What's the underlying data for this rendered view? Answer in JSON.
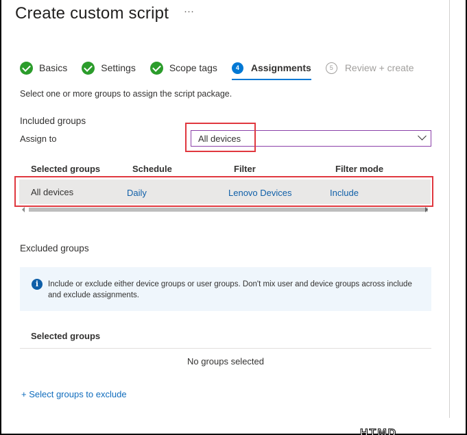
{
  "page": {
    "title": "Create custom script",
    "more": "···"
  },
  "wizard": {
    "steps": [
      {
        "label": "Basics",
        "state": "done"
      },
      {
        "label": "Settings",
        "state": "done"
      },
      {
        "label": "Scope tags",
        "state": "done"
      },
      {
        "label": "Assignments",
        "state": "active",
        "number": "4"
      },
      {
        "label": "Review + create",
        "state": "todo",
        "number": "5"
      }
    ]
  },
  "assignments": {
    "description": "Select one or more groups to assign the script package.",
    "included_label": "Included groups",
    "assign_to_label": "Assign to",
    "assign_to_value": "All devices",
    "table": {
      "headers": [
        "Selected groups",
        "Schedule",
        "Filter",
        "Filter mode"
      ],
      "row": [
        "All devices",
        "Daily",
        "Lenovo Devices",
        "Include"
      ]
    },
    "excluded_label": "Excluded groups",
    "info_text": "Include or exclude either device groups or user groups. Don't mix user and device groups across include and exclude assignments.",
    "excluded_table": {
      "header": "Selected groups",
      "empty": "No groups selected"
    },
    "exclude_link": "+ Select groups to exclude"
  },
  "colors": {
    "check_green": "#2b9c2b",
    "accent_blue": "#0078d4",
    "highlight_red": "#e0373e",
    "select_border": "#8a3fa8"
  },
  "watermark": "HTMD"
}
